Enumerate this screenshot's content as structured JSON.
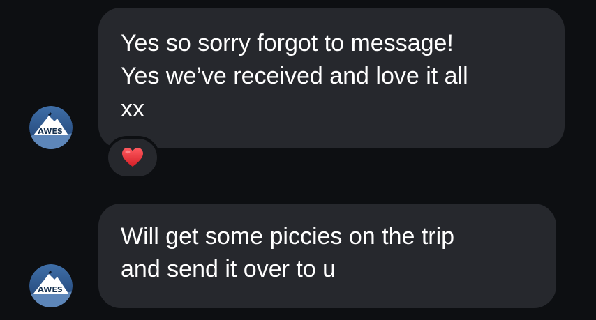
{
  "messages": [
    {
      "sender": "other",
      "avatar_icon": "mountain-logo-icon",
      "text": "Yes so sorry forgot to message!\nYes we’ve received and love it all\nxx",
      "reaction": "heart-icon"
    },
    {
      "sender": "other",
      "avatar_icon": "mountain-logo-icon",
      "text": "Will get some piccies on the trip\nand send it over to u"
    }
  ],
  "colors": {
    "background": "#0d0f12",
    "bubble": "#26282d",
    "text": "#ffffff",
    "heart": "#e0282e"
  }
}
